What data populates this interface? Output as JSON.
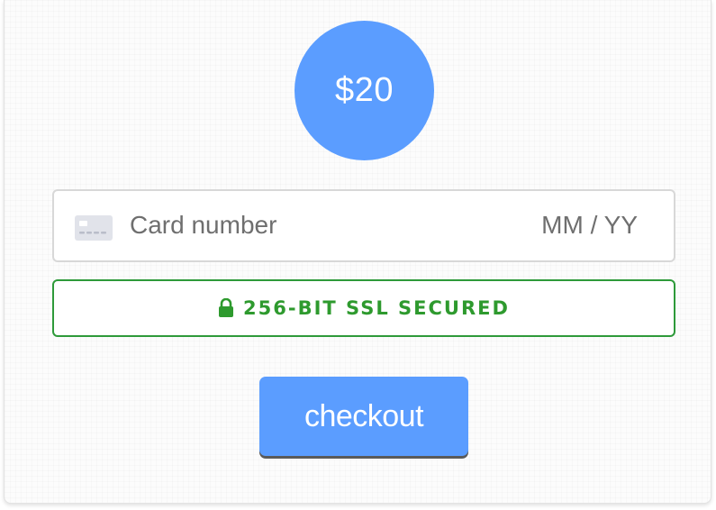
{
  "checkout": {
    "price": "$20",
    "card_field": {
      "placeholder": "Card number",
      "expiry_placeholder": "MM / YY",
      "icon": "credit-card-icon"
    },
    "security_notice": {
      "icon": "lock-icon",
      "text": "256-BIT SSL SECURED"
    },
    "submit_label": "checkout"
  },
  "colors": {
    "accent": "#5b9dff",
    "secure_green": "#2e9a2e",
    "placeholder_text": "#6f6f6f",
    "input_border": "#d8d8d8"
  }
}
